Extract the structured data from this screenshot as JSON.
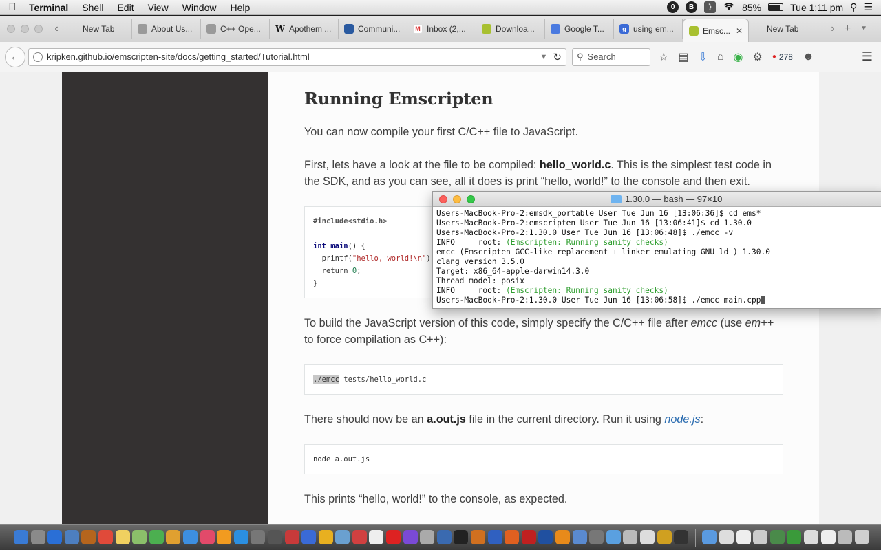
{
  "menubar": {
    "app": "Terminal",
    "items": [
      "Shell",
      "Edit",
      "View",
      "Window",
      "Help"
    ],
    "status_icons": [
      "0",
      "B",
      "}"
    ],
    "battery": "85%",
    "clock": "Tue 1:11 pm"
  },
  "browser": {
    "tabs": [
      {
        "label": "New Tab",
        "fav": ""
      },
      {
        "label": "About Us...",
        "fav": ""
      },
      {
        "label": "C++ Ope...",
        "fav": ""
      },
      {
        "label": "Apothem ...",
        "fav": "W"
      },
      {
        "label": "Communi...",
        "fav": ""
      },
      {
        "label": "Inbox (2,...",
        "fav": "M"
      },
      {
        "label": "Downloa...",
        "fav": ""
      },
      {
        "label": "Google T...",
        "fav": ""
      },
      {
        "label": "using em...",
        "fav": "g"
      }
    ],
    "active_tab": {
      "label": "Emsc..."
    },
    "new_tab": {
      "label": "New Tab"
    },
    "url": "kripken.github.io/emscripten-site/docs/getting_started/Tutorial.html",
    "search_placeholder": "Search",
    "badge_count": "278"
  },
  "article": {
    "heading": "Running Emscripten",
    "p1": "You can now compile your first C/C++ file to JavaScript.",
    "p2": {
      "pre": "First, lets have a look at the file to be compiled: ",
      "bold": "hello_world.c",
      "post": ". This is the simplest test code in the SDK, and as you can see, all it does is print “hello, world!” to the console and then exit."
    },
    "code1": {
      "line1": "#include<stdio.h>",
      "kw_int": "int",
      "fn_main": "main",
      "sig_rest": "() {",
      "printf": "  printf(",
      "printf_str": "\"hello, world!\\n\"",
      "printf_end": ");",
      "return_kw": "  return ",
      "return_val": "0",
      "return_end": ";",
      "close": "}"
    },
    "p3": {
      "pre": "To build the JavaScript version of this code, simply specify the C/C++ file after ",
      "em1": "emcc",
      "mid": " (use ",
      "em2": "em++",
      "post": " to force compilation as C++):"
    },
    "code2": {
      "highlight": "./emcc",
      "rest": " tests/hello_world.c"
    },
    "p4": {
      "pre": "There should now be an ",
      "bold": "a.out.js",
      "mid": " file in the current directory. Run it using ",
      "link": "node.js",
      "post": ":"
    },
    "code3": "node a.out.js",
    "p5": "This prints “hello, world!” to the console, as expected."
  },
  "terminal": {
    "title": "1.30.0 — bash — 97×10",
    "lines": [
      {
        "a": "Users-MacBook-Pro-2:emsdk_portable User Tue Jun 16 [13:06:36]$ cd ems*",
        "g": "",
        "b": ""
      },
      {
        "a": "Users-MacBook-Pro-2:emscripten User Tue Jun 16 [13:06:41]$ cd 1.30.0",
        "g": "",
        "b": ""
      },
      {
        "a": "Users-MacBook-Pro-2:1.30.0 User Tue Jun 16 [13:06:48]$ ./emcc -v",
        "g": "",
        "b": ""
      },
      {
        "a": "INFO     root: ",
        "g": "(Emscripten: Running sanity checks)",
        "b": ""
      },
      {
        "a": "emcc (Emscripten GCC-like replacement + linker emulating GNU ld ) 1.30.0",
        "g": "",
        "b": ""
      },
      {
        "a": "clang version 3.5.0",
        "g": "",
        "b": ""
      },
      {
        "a": "Target: x86_64-apple-darwin14.3.0",
        "g": "",
        "b": ""
      },
      {
        "a": "Thread model: posix",
        "g": "",
        "b": ""
      },
      {
        "a": "INFO     root: ",
        "g": "(Emscripten: Running sanity checks)",
        "b": ""
      },
      {
        "a": "Users-MacBook-Pro-2:1.30.0 User Tue Jun 16 [13:06:58]$ ./emcc main.cpp",
        "g": "",
        "b": ""
      }
    ]
  },
  "colors": {
    "dark_sidebar": "#343131",
    "link": "#2b6cb0",
    "terminal_green": "#2f9e2f"
  },
  "dock": {
    "colors": [
      "#3a7bd5",
      "#8a8a8a",
      "#2a6fd6",
      "#4d7fc0",
      "#b5651d",
      "#e04a3a",
      "#f0d060",
      "#8bbf6a",
      "#4caf50",
      "#e0a030",
      "#3d8fe0",
      "#e24a6a",
      "#f29b20",
      "#2b8fe0",
      "#777",
      "#555",
      "#c83a3a",
      "#3a6ad6",
      "#e8b020",
      "#6aa0d0",
      "#d04040",
      "#eee",
      "#d22",
      "#7a4ad6",
      "#aaa",
      "#3a6ab0",
      "#222",
      "#d07020",
      "#3060c0",
      "#e06020",
      "#c02020",
      "#2050a0",
      "#e88a1a",
      "#5a8ad0",
      "#777",
      "#5aa0e0",
      "#bbb",
      "#ddd",
      "#d0a020",
      "#333"
    ],
    "after_sep_colors": [
      "#5a9ae0",
      "#ddd",
      "#eee",
      "#ccc",
      "#4a8a4a",
      "#3a9a3a",
      "#ddd",
      "#eee",
      "#bbb"
    ]
  }
}
